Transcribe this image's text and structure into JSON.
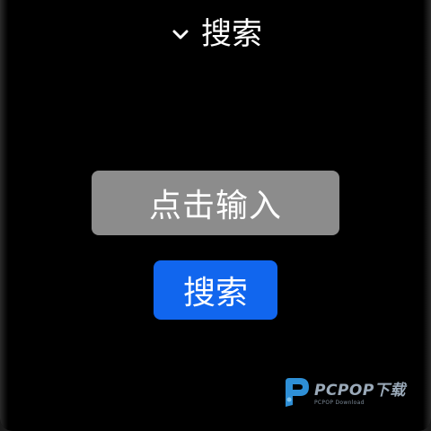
{
  "header": {
    "title": "搜索",
    "chevron_icon": "chevron-down-icon"
  },
  "input": {
    "placeholder": "点击输入"
  },
  "search_button": {
    "label": "搜索",
    "color": "#1166ee"
  },
  "input_color": "#8c8c8c",
  "watermark": {
    "brand": "PCPOP下载",
    "subtitle": "PCPOP Download",
    "icon": "pcpop-logo-icon"
  }
}
